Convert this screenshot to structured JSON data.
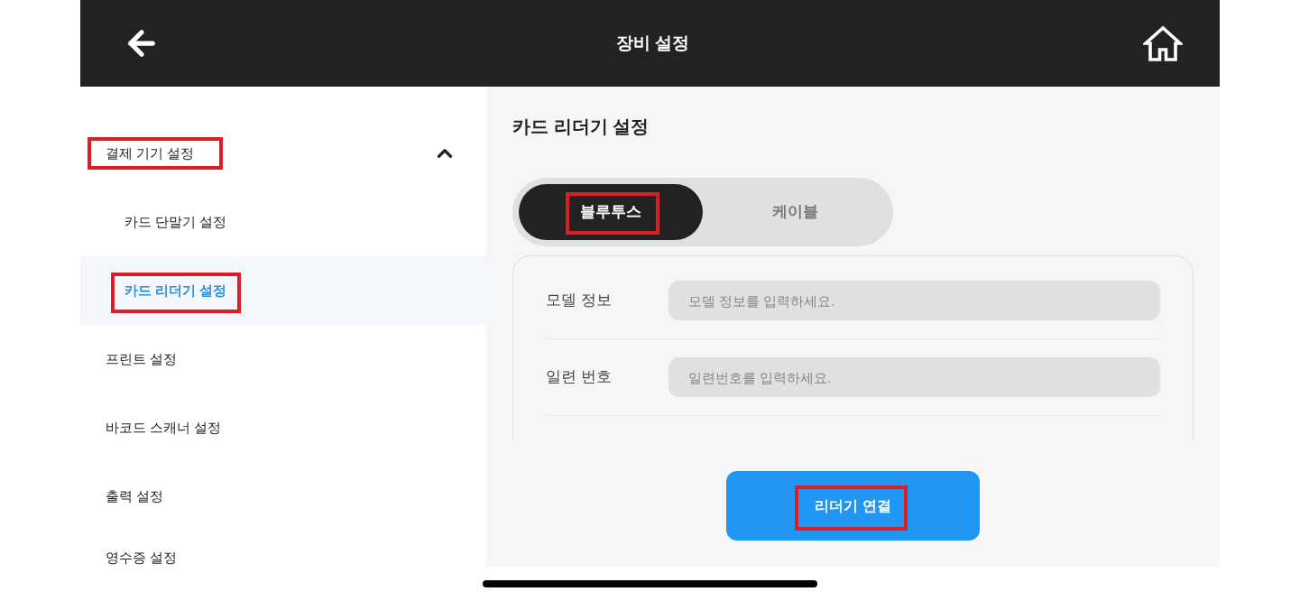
{
  "header": {
    "title": "장비 설정"
  },
  "sidebar": {
    "items": [
      {
        "label": "결제 기기 설정",
        "selected": false,
        "highlighted": true,
        "expanded": true,
        "children": [
          {
            "label": "카드 단말기 설정",
            "selected": false,
            "highlighted": false
          },
          {
            "label": "카드 리더기 설정",
            "selected": true,
            "highlighted": true
          }
        ]
      },
      {
        "label": "프린트 설정",
        "selected": false,
        "highlighted": false
      },
      {
        "label": "바코드 스캐너 설정",
        "selected": false,
        "highlighted": false
      },
      {
        "label": "출력 설정",
        "selected": false,
        "highlighted": false
      },
      {
        "label": "영수증 설정",
        "selected": false,
        "highlighted": false
      }
    ]
  },
  "panel": {
    "title": "카드 리더기 설정",
    "connection_tabs": [
      {
        "label": "블루투스",
        "selected": true,
        "highlighted": true
      },
      {
        "label": "케이블",
        "selected": false,
        "highlighted": false
      }
    ],
    "fields": [
      {
        "label": "모델 정보",
        "placeholder": "모델 정보를 입력하세요."
      },
      {
        "label": "일련 번호",
        "placeholder": "일련번호를 입력하세요."
      }
    ],
    "button": {
      "label": "리더기 연결",
      "highlighted": true
    }
  }
}
